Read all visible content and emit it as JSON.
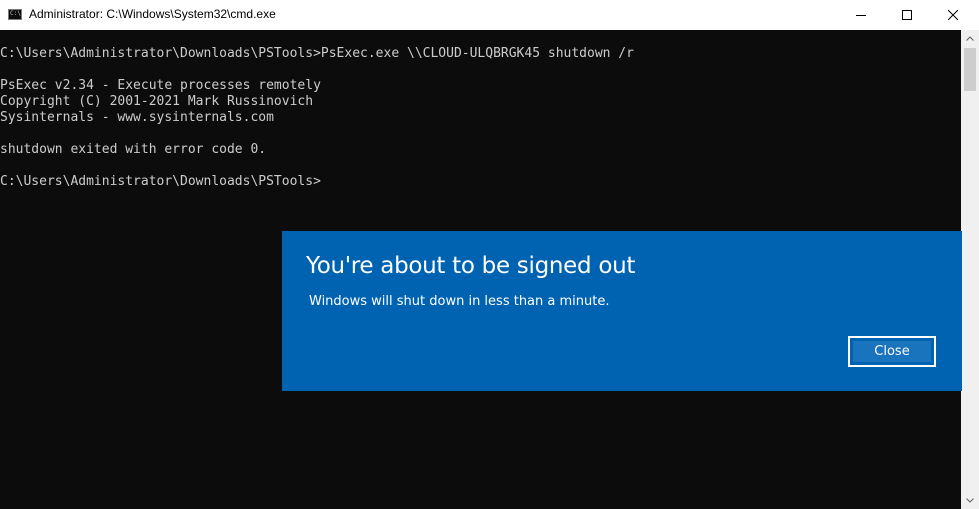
{
  "window": {
    "title": "Administrator: C:\\Windows\\System32\\cmd.exe",
    "icon_text": "C:\\",
    "controls": {
      "minimize": "minimize-icon",
      "maximize": "maximize-icon",
      "close": "close-icon"
    }
  },
  "console": {
    "lines": [
      "C:\\Users\\Administrator\\Downloads\\PSTools>PsExec.exe \\\\CLOUD-ULQBRGK45 shutdown /r",
      "",
      "PsExec v2.34 - Execute processes remotely",
      "Copyright (C) 2001-2021 Mark Russinovich",
      "Sysinternals - www.sysinternals.com",
      "",
      "shutdown exited with error code 0.",
      "",
      "C:\\Users\\Administrator\\Downloads\\PSTools>"
    ],
    "foreground": "#cccccc",
    "background": "#0c0c0c"
  },
  "dialog": {
    "title": "You're about to be signed out",
    "message": "Windows will shut down in less than a minute.",
    "close_label": "Close",
    "background": "#0063b1"
  }
}
